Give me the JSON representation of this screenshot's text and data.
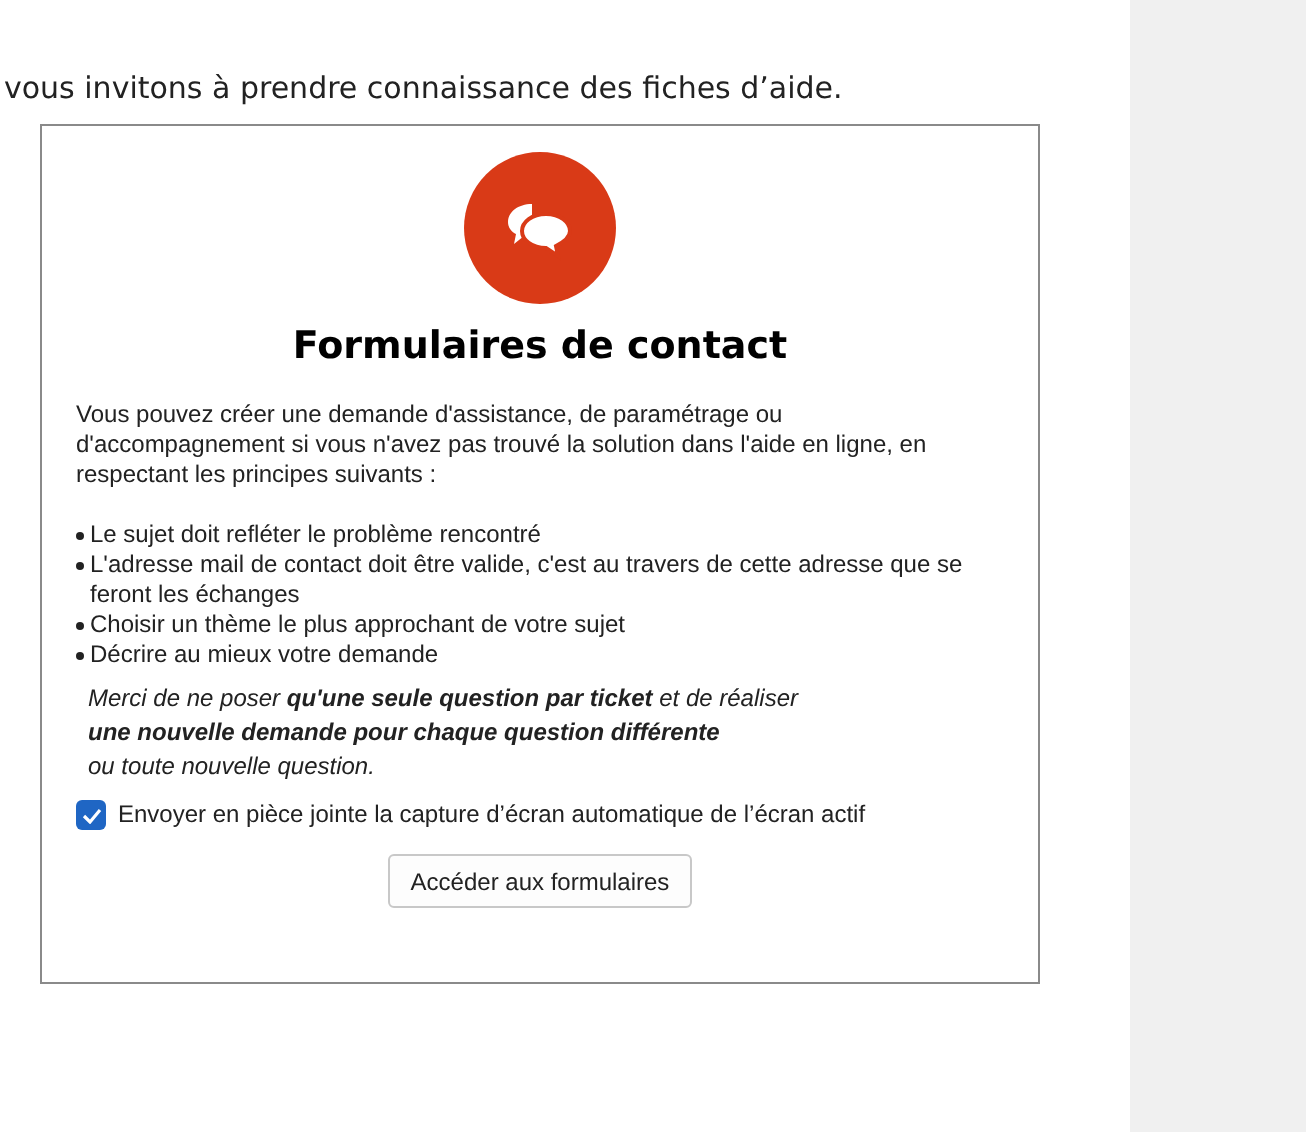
{
  "intro": "vous invitons à prendre connaissance des fiches d’aide.",
  "card": {
    "title": "Formulaires de contact",
    "description": "Vous pouvez créer une demande d'assistance, de paramétrage ou d'accompagnement si vous n'avez pas trouvé la solution dans l'aide en ligne, en respectant les principes suivants :",
    "principles": [
      "Le sujet doit refléter le problème rencontré",
      "L'adresse mail de contact doit être valide, c'est au travers de cette adresse que se feront les échanges",
      "Choisir un thème le plus approchant de votre sujet",
      "Décrire au mieux votre demande"
    ],
    "note_lines": [
      "Merci de ne poser  **qu'une seule question par ticket** et de réaliser",
      "**une nouvelle demande pour chaque question différente**",
      "ou toute nouvelle question."
    ],
    "screenshot_option": {
      "label": "Envoyer en pièce jointe la capture d’écran automatique de l’écran actif",
      "checked": true
    },
    "button": "Accéder aux formulaires"
  }
}
